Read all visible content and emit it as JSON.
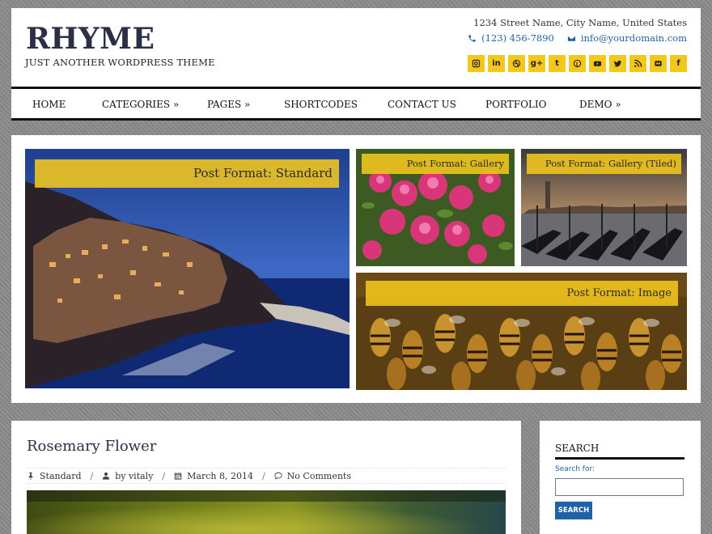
{
  "site": {
    "title": "RHYME",
    "tagline": "JUST ANOTHER WORDPRESS THEME",
    "address": "1234 Street Name, City Name, United States",
    "phone": "(123) 456-7890",
    "email": "info@yourdomain.com",
    "social": [
      {
        "name": "instagram",
        "glyph": ""
      },
      {
        "name": "linkedin",
        "glyph": "in"
      },
      {
        "name": "dribbble",
        "glyph": ""
      },
      {
        "name": "google-plus",
        "glyph": "g+"
      },
      {
        "name": "tumblr",
        "glyph": "t"
      },
      {
        "name": "pinterest",
        "glyph": ""
      },
      {
        "name": "youtube",
        "glyph": ""
      },
      {
        "name": "twitter",
        "glyph": ""
      },
      {
        "name": "rss",
        "glyph": ""
      },
      {
        "name": "flickr",
        "glyph": ""
      },
      {
        "name": "facebook",
        "glyph": "f"
      }
    ],
    "accent": "#f4c71c",
    "link_color": "#1f62a5"
  },
  "nav": {
    "items": [
      "HOME",
      "CATEGORIES »",
      "PAGES »",
      "SHORTCODES",
      "CONTACT US",
      "PORTFOLIO",
      "DEMO »"
    ]
  },
  "featured": {
    "tiles": [
      "Post Format: Standard",
      "Post Format: Gallery",
      "Post Format: Gallery (Tiled)",
      "Post Format: Image"
    ]
  },
  "post": {
    "title": "Rosemary Flower",
    "format": "Standard",
    "author": "by vitaly",
    "date": "March 8, 2014",
    "comments": "No Comments",
    "separator": "/"
  },
  "sidebar": {
    "search_title": "SEARCH",
    "search_label": "Search for:",
    "search_button": "SEARCH"
  }
}
